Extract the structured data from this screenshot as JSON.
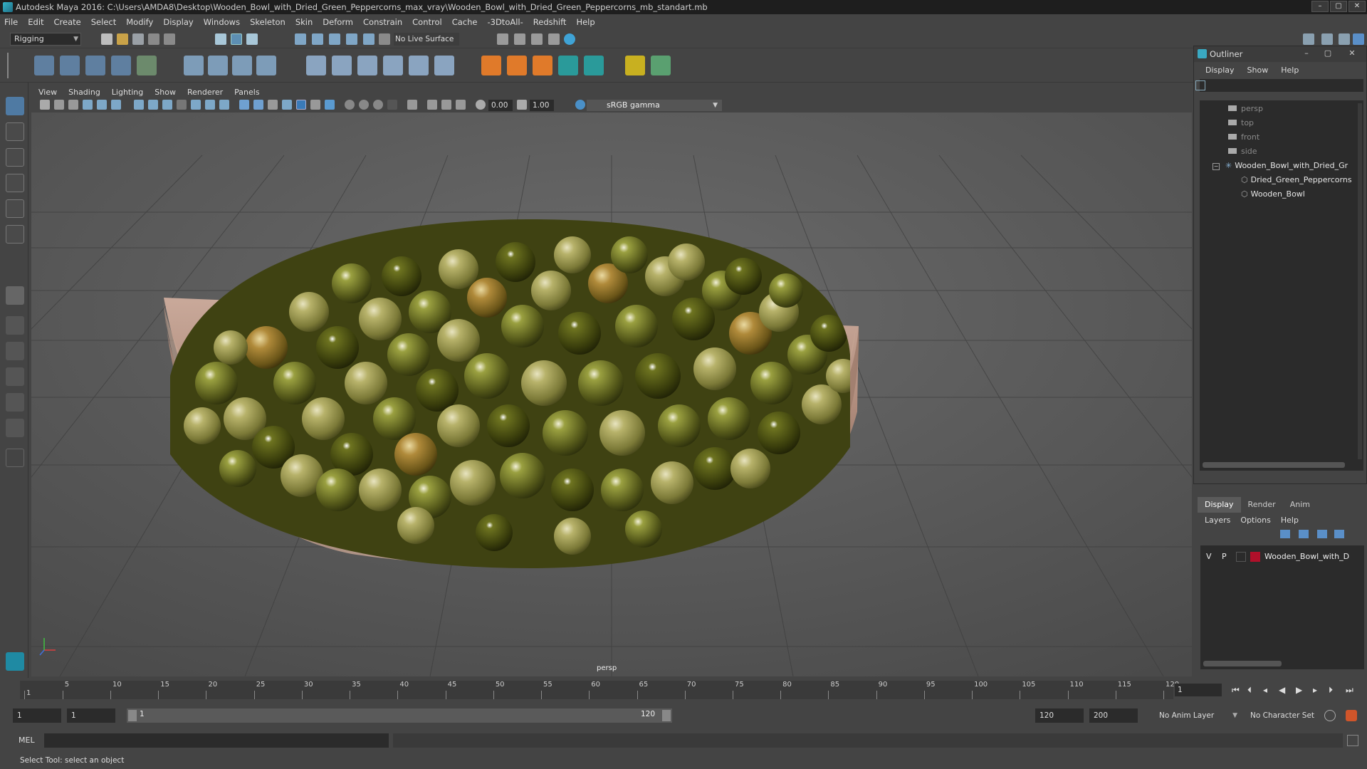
{
  "window": {
    "title": "Autodesk Maya 2016: C:\\Users\\AMDA8\\Desktop\\Wooden_Bowl_with_Dried_Green_Peppercorns_max_vray\\Wooden_Bowl_with_Dried_Green_Peppercorns_mb_standart.mb",
    "minimize": "–",
    "maximize": "▢",
    "close": "✕"
  },
  "menubar": [
    "File",
    "Edit",
    "Create",
    "Select",
    "Modify",
    "Display",
    "Windows",
    "Skeleton",
    "Skin",
    "Deform",
    "Constrain",
    "Control",
    "Cache",
    "-3DtoAll-",
    "Redshift",
    "Help"
  ],
  "status": {
    "mode": "Rigging",
    "live_surface": "No Live Surface"
  },
  "viewport": {
    "menu": [
      "View",
      "Shading",
      "Lighting",
      "Show",
      "Renderer",
      "Panels"
    ],
    "exposure": "0.00",
    "gamma": "1.00",
    "colorspace": "sRGB gamma",
    "camera_label": "persp"
  },
  "outliner": {
    "title": "Outliner",
    "menu": [
      "Display",
      "Show",
      "Help"
    ],
    "items": [
      {
        "label": "persp",
        "dim": true
      },
      {
        "label": "top",
        "dim": true
      },
      {
        "label": "front",
        "dim": true
      },
      {
        "label": "side",
        "dim": true
      },
      {
        "label": "Wooden_Bowl_with_Dried_Gr",
        "dim": false
      },
      {
        "label": "Dried_Green_Peppercorns",
        "dim": false
      },
      {
        "label": "Wooden_Bowl",
        "dim": false
      }
    ]
  },
  "layers": {
    "tabs": [
      "Display",
      "Render",
      "Anim"
    ],
    "menu": [
      "Layers",
      "Options",
      "Help"
    ],
    "row": {
      "v": "V",
      "p": "P",
      "name": "Wooden_Bowl_with_D",
      "color": "#b0102a"
    }
  },
  "timeline": {
    "ticks": [
      "1",
      "5",
      "10",
      "15",
      "20",
      "25",
      "30",
      "35",
      "40",
      "45",
      "50",
      "55",
      "60",
      "65",
      "70",
      "75",
      "80",
      "85",
      "90",
      "95",
      "100",
      "105",
      "110",
      "115",
      "120"
    ],
    "current_frame": "1"
  },
  "range": {
    "start": "1",
    "playback_start": "1",
    "slider_start": "1",
    "slider_end": "120",
    "playback_end": "120",
    "end": "200",
    "anim_layer": "No Anim Layer",
    "character_set": "No Character Set"
  },
  "cmd": {
    "label": "MEL"
  },
  "help_line": "Select Tool: select an object"
}
